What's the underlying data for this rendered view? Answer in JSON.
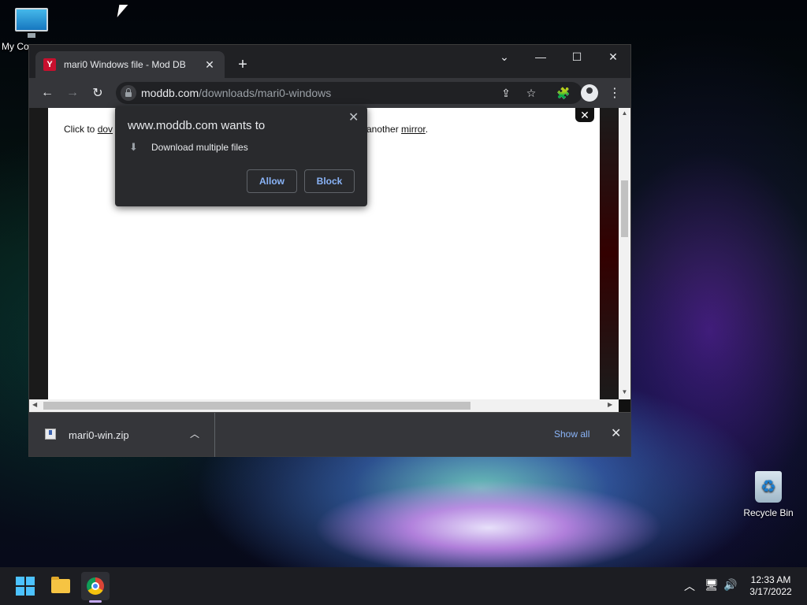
{
  "desktop": {
    "icons": [
      {
        "label": "My Co",
        "icon": "computer-icon"
      },
      {
        "label": "Recycle Bin",
        "icon": "recycle-bin-icon"
      }
    ]
  },
  "browser": {
    "tab": {
      "title": "mari0 Windows file - Mod DB",
      "favicon": "moddb-favicon",
      "favicon_glyph": "Y",
      "close_glyph": "✕"
    },
    "new_tab_glyph": "+",
    "window_controls": {
      "chevron": "⌄",
      "minimize": "—",
      "maximize": "☐",
      "close": "✕"
    },
    "toolbar": {
      "back": "←",
      "forward": "→",
      "reload": "↻",
      "share": "⇪",
      "star": "☆",
      "extensions": "🧩",
      "menu": "⋮"
    },
    "address": {
      "host": "moddb.com",
      "path": "/downloads/mari0-windows"
    },
    "page": {
      "text_start": "Click to ",
      "link_partial": "dov",
      "text_end": "another ",
      "mirror_link": "mirror",
      "text_period": ".",
      "ad_close": "✕"
    },
    "permission_prompt": {
      "title": "www.moddb.com wants to",
      "permission": "Download multiple files",
      "allow_label": "Allow",
      "block_label": "Block",
      "close_glyph": "✕",
      "download_glyph": "⬇"
    },
    "downloads_bar": {
      "file_name": "mari0-win.zip",
      "chevron": "︿",
      "show_all_label": "Show all",
      "close_glyph": "✕"
    },
    "scroll_glyphs": {
      "up": "▲",
      "down": "▼",
      "left": "◀",
      "right": "▶"
    }
  },
  "taskbar": {
    "apps": [
      "start-icon",
      "file-explorer-icon",
      "chrome-icon"
    ],
    "tray": {
      "chevron": "︿",
      "network": "🖥",
      "volume": "🔊"
    },
    "clock": {
      "time": "12:33 AM",
      "date": "3/17/2022"
    }
  },
  "colors": {
    "accent": "#8ab4f8",
    "chrome_dark": "#202124",
    "toolbar": "#35363a"
  }
}
